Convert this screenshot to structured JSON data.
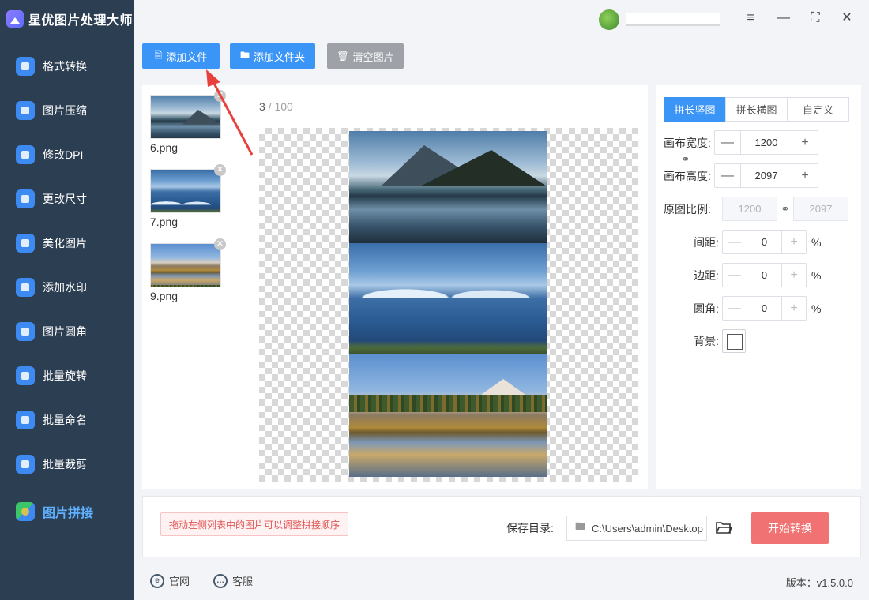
{
  "app": {
    "title": "星优图片处理大师"
  },
  "sidebar": {
    "items": [
      {
        "label": "格式转换",
        "icon": "format-convert-icon"
      },
      {
        "label": "图片压缩",
        "icon": "compress-icon"
      },
      {
        "label": "修改DPI",
        "icon": "dpi-icon"
      },
      {
        "label": "更改尺寸",
        "icon": "resize-icon"
      },
      {
        "label": "美化图片",
        "icon": "beautify-icon"
      },
      {
        "label": "添加水印",
        "icon": "watermark-icon"
      },
      {
        "label": "图片圆角",
        "icon": "round-corner-icon"
      },
      {
        "label": "批量旋转",
        "icon": "rotate-icon"
      },
      {
        "label": "批量命名",
        "icon": "rename-icon"
      },
      {
        "label": "批量裁剪",
        "icon": "crop-icon"
      },
      {
        "label": "图片拼接",
        "icon": "stitch-icon",
        "active": true
      }
    ]
  },
  "window": {
    "settings": "≡",
    "minimize": "—",
    "maximize": "⛶",
    "close": "✕"
  },
  "toolbar": {
    "add_file": "添加文件",
    "add_folder": "添加文件夹",
    "clear": "清空图片"
  },
  "files": [
    {
      "name": "6.png"
    },
    {
      "name": "7.png"
    },
    {
      "name": "9.png"
    }
  ],
  "counter": {
    "current": "3",
    "separator": " / ",
    "max": "100"
  },
  "settings": {
    "tabs": [
      "拼长竖图",
      "拼长横图",
      "自定义"
    ],
    "canvas_width_label": "画布宽度:",
    "canvas_width": "1200",
    "canvas_height_label": "画布高度:",
    "canvas_height": "2097",
    "ratio_label": "原图比例:",
    "ratio_width": "1200",
    "ratio_height": "2097",
    "spacing_label": "间距:",
    "spacing": "0",
    "margin_label": "边距:",
    "margin": "0",
    "radius_label": "圆角:",
    "radius": "0",
    "background_label": "背景:",
    "percent": "%",
    "minus": "—",
    "plus": "+"
  },
  "bottom": {
    "hint": "拖动左侧列表中的图片可以调整拼接顺序",
    "save_label": "保存目录:",
    "save_path": "C:\\Users\\admin\\Desktop",
    "start": "开始转换"
  },
  "footer": {
    "website": "官网",
    "service": "客服",
    "version": "版本：v1.5.0.0"
  },
  "colors": {
    "accent": "#3b95f7",
    "sidebar": "#2c3e52",
    "start_button": "#f07272",
    "arrow": "#e8413d"
  }
}
